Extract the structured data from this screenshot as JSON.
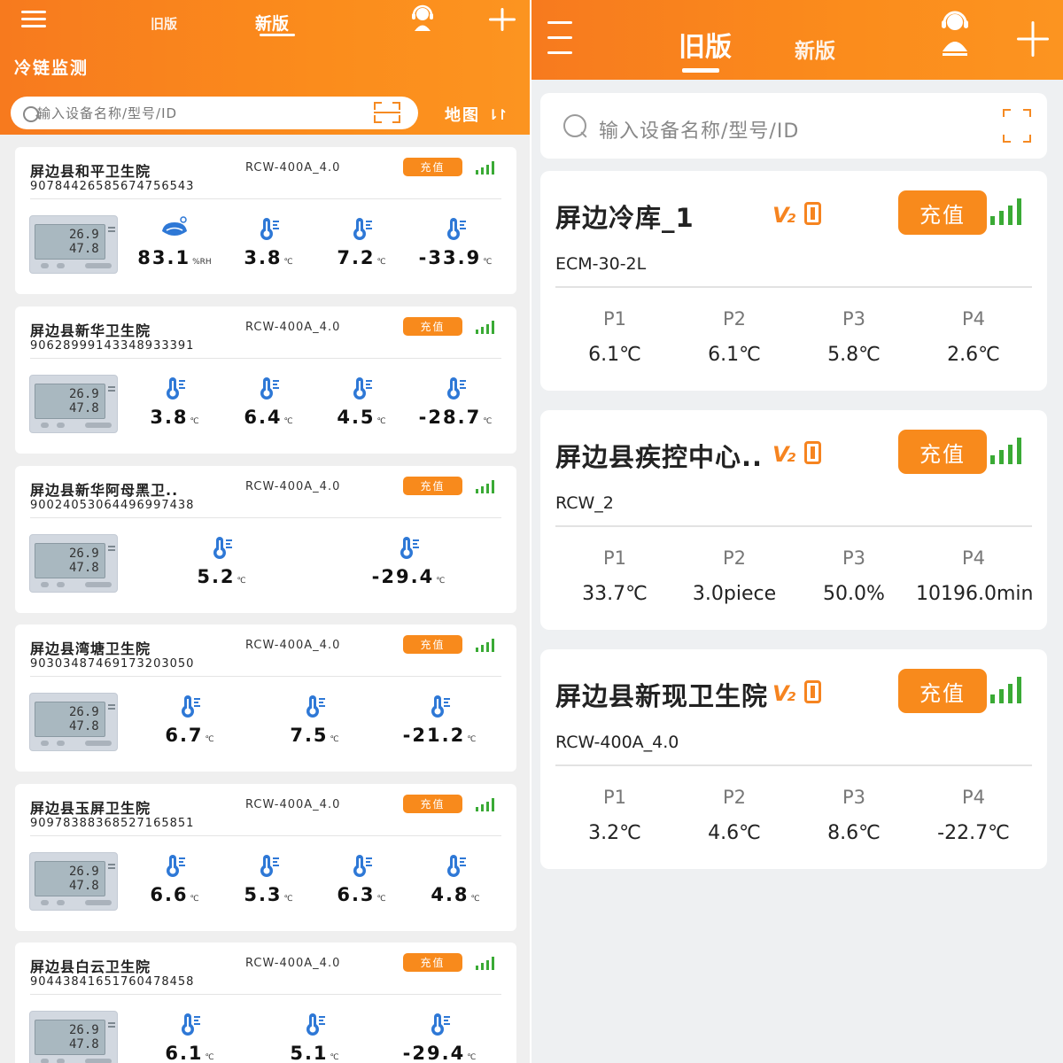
{
  "left": {
    "header": {
      "tab_old": "旧版",
      "tab_new": "新版",
      "title": "冷链监测"
    },
    "search": {
      "placeholder": "输入设备名称/型号/ID"
    },
    "map": {
      "label": "地图"
    },
    "devices": [
      {
        "name": "屏边县和平卫生院",
        "model": "RCW-400A_4.0",
        "recharge": "充值",
        "serial": "90784426585674756543",
        "readings": [
          {
            "value": "83.1",
            "unit": "%RH",
            "kind": "humidity"
          },
          {
            "value": "3.8",
            "unit": "℃",
            "kind": "temperature"
          },
          {
            "value": "7.2",
            "unit": "℃",
            "kind": "temperature"
          },
          {
            "value": "-33.9",
            "unit": "℃",
            "kind": "temperature"
          }
        ]
      },
      {
        "name": "屏边县新华卫生院",
        "model": "RCW-400A_4.0",
        "recharge": "充值",
        "serial": "90628999143348933391",
        "readings": [
          {
            "value": "3.8",
            "unit": "℃",
            "kind": "temperature"
          },
          {
            "value": "6.4",
            "unit": "℃",
            "kind": "temperature"
          },
          {
            "value": "4.5",
            "unit": "℃",
            "kind": "temperature"
          },
          {
            "value": "-28.7",
            "unit": "℃",
            "kind": "temperature"
          }
        ]
      },
      {
        "name": "屏边县新华阿母黑卫..",
        "model": "RCW-400A_4.0",
        "recharge": "充值",
        "serial": "90024053064496997438",
        "readings": [
          {
            "value": "5.2",
            "unit": "℃",
            "kind": "temperature"
          },
          {
            "value": "-29.4",
            "unit": "℃",
            "kind": "temperature"
          }
        ]
      },
      {
        "name": "屏边县湾塘卫生院",
        "model": "RCW-400A_4.0",
        "recharge": "充值",
        "serial": "90303487469173203050",
        "readings": [
          {
            "value": "6.7",
            "unit": "℃",
            "kind": "temperature"
          },
          {
            "value": "7.5",
            "unit": "℃",
            "kind": "temperature"
          },
          {
            "value": "-21.2",
            "unit": "℃",
            "kind": "temperature"
          }
        ]
      },
      {
        "name": "屏边县玉屏卫生院",
        "model": "RCW-400A_4.0",
        "recharge": "充值",
        "serial": "90978388368527165851",
        "readings": [
          {
            "value": "6.6",
            "unit": "℃",
            "kind": "temperature"
          },
          {
            "value": "5.3",
            "unit": "℃",
            "kind": "temperature"
          },
          {
            "value": "6.3",
            "unit": "℃",
            "kind": "temperature"
          },
          {
            "value": "4.8",
            "unit": "℃",
            "kind": "temperature"
          }
        ]
      },
      {
        "name": "屏边县白云卫生院",
        "model": "RCW-400A_4.0",
        "recharge": "充值",
        "serial": "90443841651760478458",
        "readings": [
          {
            "value": "6.1",
            "unit": "℃",
            "kind": "temperature"
          },
          {
            "value": "5.1",
            "unit": "℃",
            "kind": "temperature"
          },
          {
            "value": "-29.4",
            "unit": "℃",
            "kind": "temperature"
          }
        ]
      }
    ],
    "device_screen": {
      "line1": "26.9",
      "line2": "47.8"
    }
  },
  "right": {
    "header": {
      "tab_old": "旧版",
      "tab_new": "新版"
    },
    "search": {
      "placeholder": "输入设备名称/型号/ID"
    },
    "devices": [
      {
        "name": "屏边冷库_1",
        "model": "ECM-30-2L",
        "recharge": "充值",
        "probes": [
          {
            "label": "P1",
            "value": "6.1℃"
          },
          {
            "label": "P2",
            "value": "6.1℃"
          },
          {
            "label": "P3",
            "value": "5.8℃"
          },
          {
            "label": "P4",
            "value": "2.6℃"
          }
        ]
      },
      {
        "name": "屏边县疾控中心..",
        "model": "RCW_2",
        "recharge": "充值",
        "probes": [
          {
            "label": "P1",
            "value": "33.7℃"
          },
          {
            "label": "P2",
            "value": "3.0piece"
          },
          {
            "label": "P3",
            "value": "50.0%"
          },
          {
            "label": "P4",
            "value": "10196.0min"
          }
        ]
      },
      {
        "name": "屏边县新现卫生院",
        "model": "RCW-400A_4.0",
        "recharge": "充值",
        "probes": [
          {
            "label": "P1",
            "value": "3.2℃"
          },
          {
            "label": "P2",
            "value": "4.6℃"
          },
          {
            "label": "P3",
            "value": "8.6℃"
          },
          {
            "label": "P4",
            "value": "-22.7℃"
          }
        ]
      }
    ]
  },
  "colors": {
    "accent": "#f98a1d",
    "signal": "#3aaa35",
    "page_bg": "#efefef"
  }
}
